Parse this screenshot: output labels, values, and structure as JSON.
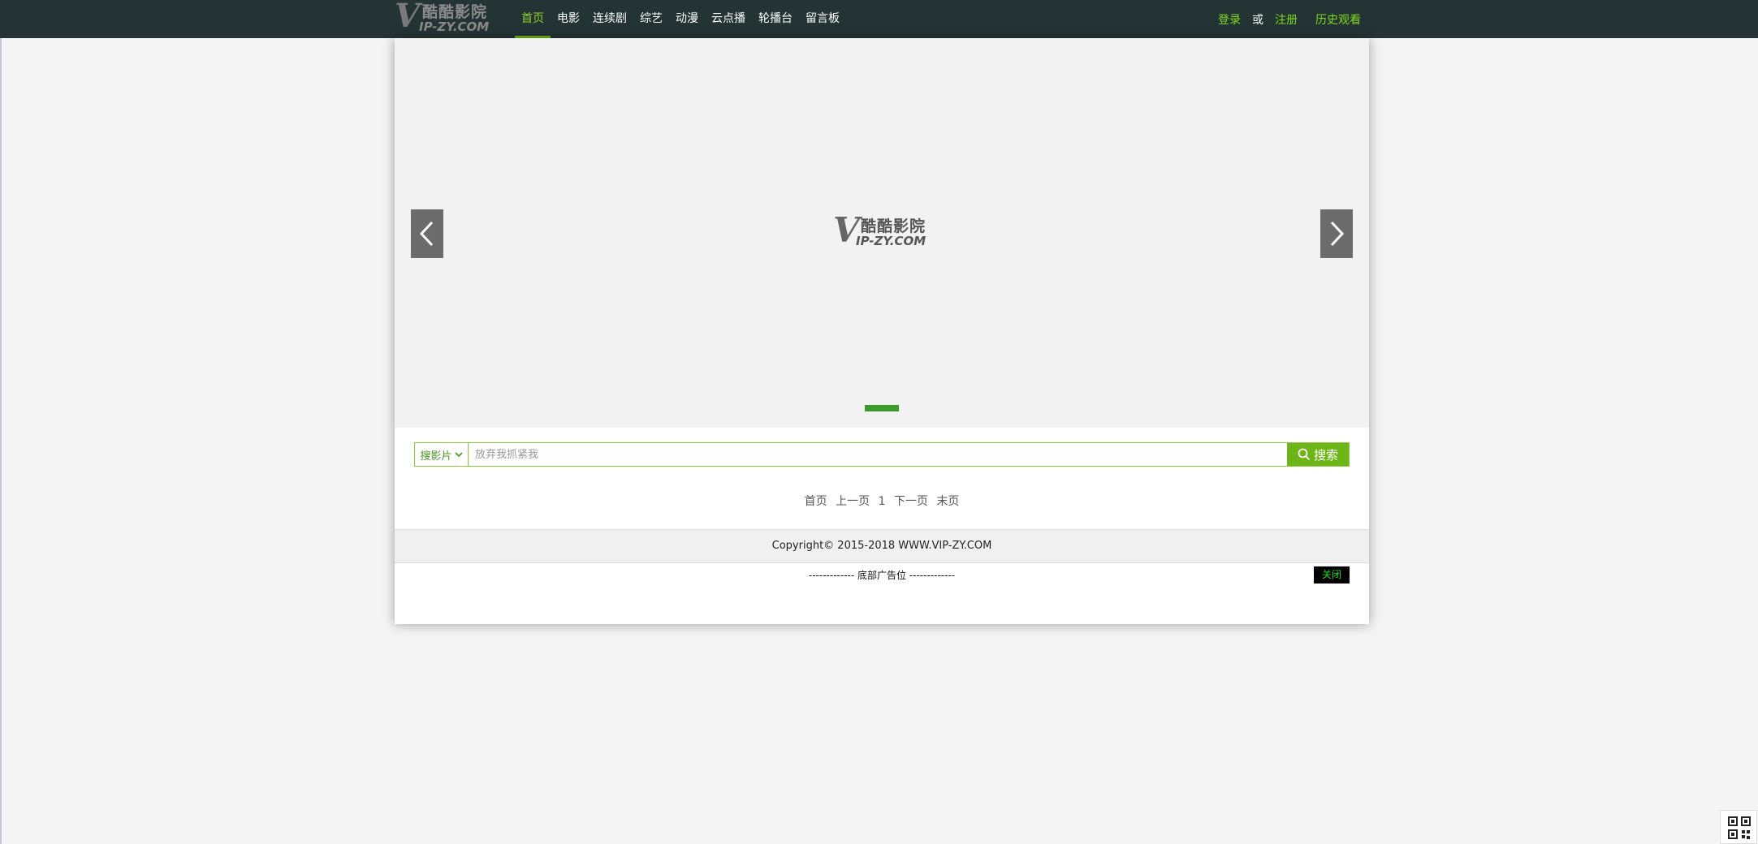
{
  "brand": {
    "logo_letter": "V",
    "logo_cn": "酷酷影院",
    "logo_en": "IP-ZY.COM"
  },
  "nav": {
    "items": [
      {
        "label": "首页",
        "active": true
      },
      {
        "label": "电影"
      },
      {
        "label": "连续剧"
      },
      {
        "label": "综艺"
      },
      {
        "label": "动漫"
      },
      {
        "label": "云点播"
      },
      {
        "label": "轮播台"
      },
      {
        "label": "留言板"
      }
    ]
  },
  "user": {
    "login": "登录",
    "or": "或",
    "register": "注册",
    "history": "历史观看"
  },
  "banner": {
    "logo_letter": "V",
    "logo_cn": "酷酷影院",
    "logo_en": "IP-ZY.COM",
    "prev_icon": "chevron-left",
    "next_icon": "chevron-right"
  },
  "search": {
    "type_label": "搜影片",
    "placeholder": "放弃我抓紧我",
    "value": "",
    "button_label": "搜索"
  },
  "pager": {
    "first": "首页",
    "prev": "上一页",
    "current": "1",
    "next": "下一页",
    "last": "末页"
  },
  "footer": {
    "copyright": "Copyright© 2015-2018 WWW.VIP-ZY.COM",
    "ad_text": "------------- 底部广告位 -------------",
    "close_label": "关闭"
  },
  "colors": {
    "topbar": "#243434",
    "accent_green": "#6db516",
    "link_green": "#7fd81c",
    "banner_bg": "#f2f2f2"
  }
}
